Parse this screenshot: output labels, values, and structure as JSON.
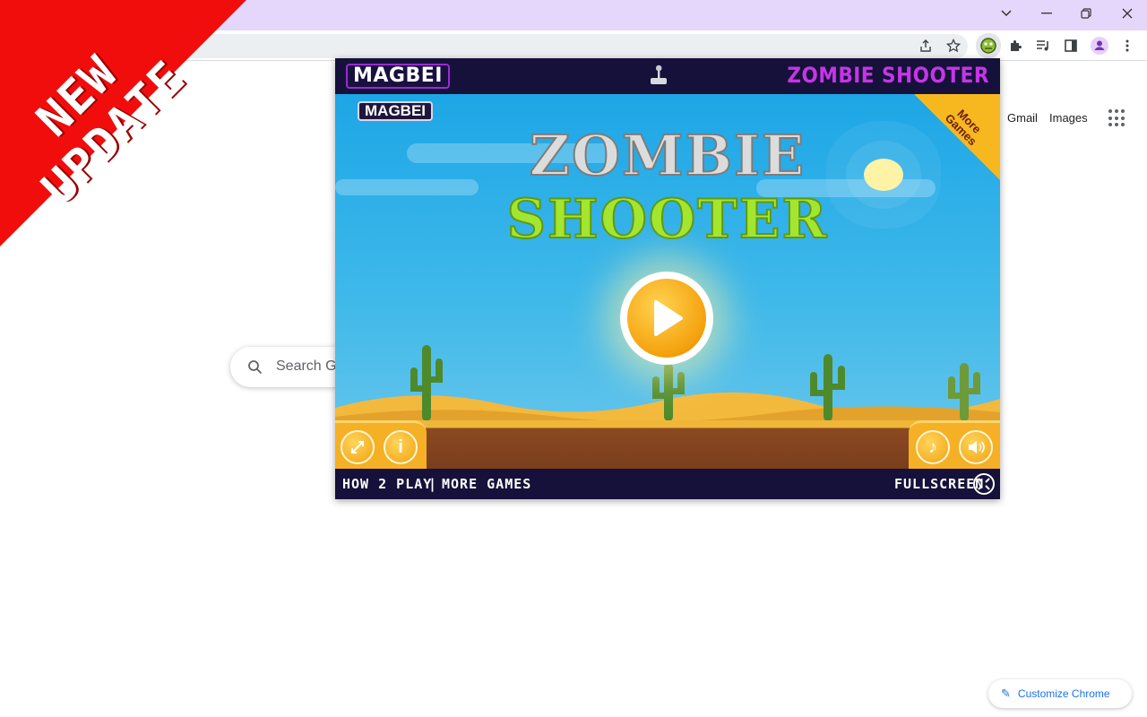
{
  "browser": {
    "window_controls": {
      "dropdown_icon": "chevron-down-icon",
      "minimize_icon": "minimize-icon",
      "restore_icon": "restore-icon",
      "close_icon": "close-icon"
    },
    "toolbar": {
      "share_icon": "share-icon",
      "bookmark_icon": "star-icon",
      "extension_icon": "zombie-extension-icon",
      "extensions_icon": "puzzle-icon",
      "media_icon": "media-icon",
      "side_panel_icon": "side-panel-icon",
      "profile_icon": "profile-icon",
      "menu_icon": "more-vert-icon"
    }
  },
  "google": {
    "links": [
      "Gmail",
      "Images"
    ],
    "search_placeholder": "Search Go",
    "customize_label": "Customize Chrome"
  },
  "banner": {
    "line1": "NEW",
    "line2": "UPDATE",
    "color": "#f20d0d"
  },
  "popup": {
    "logo": "MAGBEI",
    "title": "ZOMBIE SHOOTER",
    "game": {
      "small_logo": "MAGBEI",
      "title_line1": "ZOMBIE",
      "title_line2": "SHOOTER",
      "more_games": "More Games",
      "play_icon": "play-icon"
    },
    "footer": {
      "how_to_play": "HOW 2 PLAY",
      "separator": "|",
      "more_games": "MORE GAMES",
      "fullscreen": "FULLSCREEN"
    }
  }
}
